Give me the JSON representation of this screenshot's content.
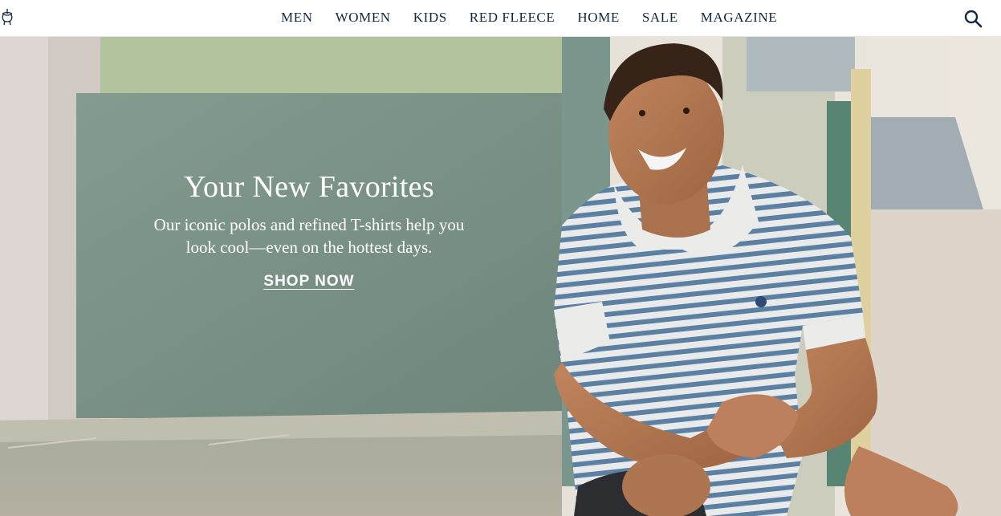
{
  "header": {
    "logo_icon": "golden-fleece-logo-icon",
    "nav": [
      {
        "label": "MEN"
      },
      {
        "label": "WOMEN"
      },
      {
        "label": "KIDS"
      },
      {
        "label": "RED FLEECE"
      },
      {
        "label": "HOME"
      },
      {
        "label": "SALE"
      },
      {
        "label": "MAGAZINE"
      }
    ],
    "search_icon": "search-icon"
  },
  "hero": {
    "title": "Your New Favorites",
    "subtitle": "Our iconic polos and refined T-shirts help you look cool—even on the hottest days.",
    "cta": "SHOP NOW"
  },
  "colors": {
    "nav_text": "#0f2742",
    "hero_text": "#ffffff",
    "wall_green": "#7f9a8f",
    "sky": "#f3efe6"
  }
}
